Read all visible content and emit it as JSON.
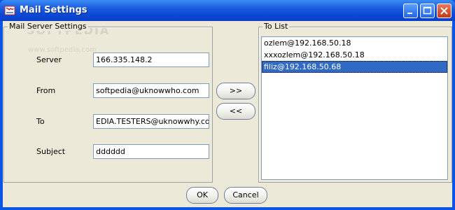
{
  "window": {
    "title": "Mail Settings"
  },
  "mail_server": {
    "legend": "Mail Server Settings",
    "server": {
      "label": "Server",
      "value": "166.335.148.2"
    },
    "from": {
      "label": "From",
      "value": "softpedia@uknowwho.com"
    },
    "to": {
      "label": "To",
      "value": "EDIA.TESTERS@uknowwhy.com"
    },
    "subject": {
      "label": "Subject",
      "value": "dddddd"
    }
  },
  "transfer": {
    "add_label": ">>",
    "remove_label": "<<"
  },
  "to_list": {
    "legend": "To List",
    "items": [
      "ozlem@192.168.50.18",
      "xxxozlem@192.168.50.18",
      "filiz@192.168.50.68"
    ],
    "selected_index": 2
  },
  "footer": {
    "ok_label": "OK",
    "cancel_label": "Cancel"
  },
  "watermark": {
    "brand": "SOFTPEDIA",
    "url": "www.softpedia.com"
  },
  "colors": {
    "titlebar": "#0a48d6",
    "selection": "#316ac5",
    "face": "#ece9d8"
  },
  "icons": [
    "app-icon",
    "minimize-icon",
    "maximize-icon",
    "close-icon"
  ]
}
